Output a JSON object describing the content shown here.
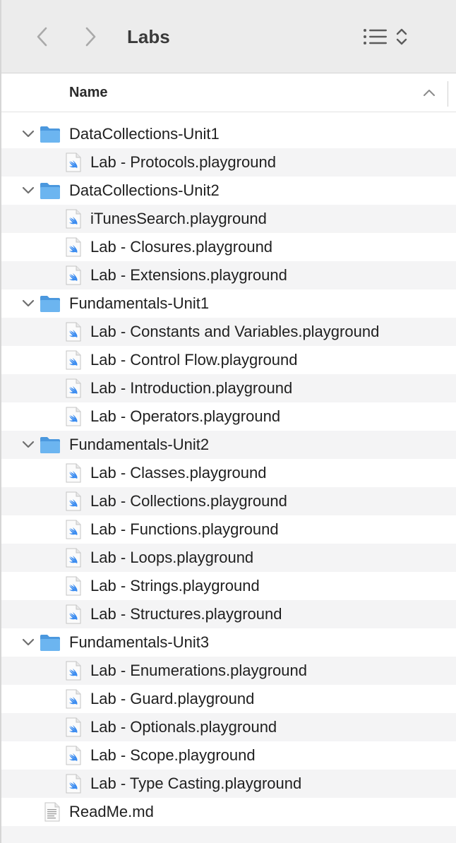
{
  "window": {
    "title": "Labs"
  },
  "toolbar": {
    "back_icon": "chevron-left-icon",
    "forward_icon": "chevron-right-icon",
    "view_icon": "list-view-icon",
    "view_menu_icon": "chevron-updown-icon"
  },
  "columns": {
    "name_label": "Name",
    "sort_direction": "ascending"
  },
  "colors": {
    "folder": "#5aa9ea",
    "row_alt": "#f4f4f5",
    "toolbar": "#ececec"
  },
  "items": [
    {
      "kind": "folder",
      "label": "DataCollections-Unit1",
      "expanded": true
    },
    {
      "kind": "playground",
      "label": "Lab - Protocols.playground"
    },
    {
      "kind": "folder",
      "label": "DataCollections-Unit2",
      "expanded": true
    },
    {
      "kind": "playground",
      "label": "iTunesSearch.playground"
    },
    {
      "kind": "playground",
      "label": "Lab - Closures.playground"
    },
    {
      "kind": "playground",
      "label": "Lab - Extensions.playground"
    },
    {
      "kind": "folder",
      "label": "Fundamentals-Unit1",
      "expanded": true
    },
    {
      "kind": "playground",
      "label": "Lab - Constants and Variables.playground"
    },
    {
      "kind": "playground",
      "label": "Lab - Control Flow.playground"
    },
    {
      "kind": "playground",
      "label": "Lab - Introduction.playground"
    },
    {
      "kind": "playground",
      "label": "Lab - Operators.playground"
    },
    {
      "kind": "folder",
      "label": "Fundamentals-Unit2",
      "expanded": true
    },
    {
      "kind": "playground",
      "label": "Lab - Classes.playground"
    },
    {
      "kind": "playground",
      "label": "Lab - Collections.playground"
    },
    {
      "kind": "playground",
      "label": "Lab - Functions.playground"
    },
    {
      "kind": "playground",
      "label": "Lab - Loops.playground"
    },
    {
      "kind": "playground",
      "label": "Lab - Strings.playground"
    },
    {
      "kind": "playground",
      "label": "Lab - Structures.playground"
    },
    {
      "kind": "folder",
      "label": "Fundamentals-Unit3",
      "expanded": true
    },
    {
      "kind": "playground",
      "label": "Lab - Enumerations.playground"
    },
    {
      "kind": "playground",
      "label": "Lab - Guard.playground"
    },
    {
      "kind": "playground",
      "label": "Lab - Optionals.playground"
    },
    {
      "kind": "playground",
      "label": "Lab - Scope.playground"
    },
    {
      "kind": "playground",
      "label": "Lab - Type Casting.playground"
    },
    {
      "kind": "document",
      "label": "ReadMe.md"
    }
  ]
}
